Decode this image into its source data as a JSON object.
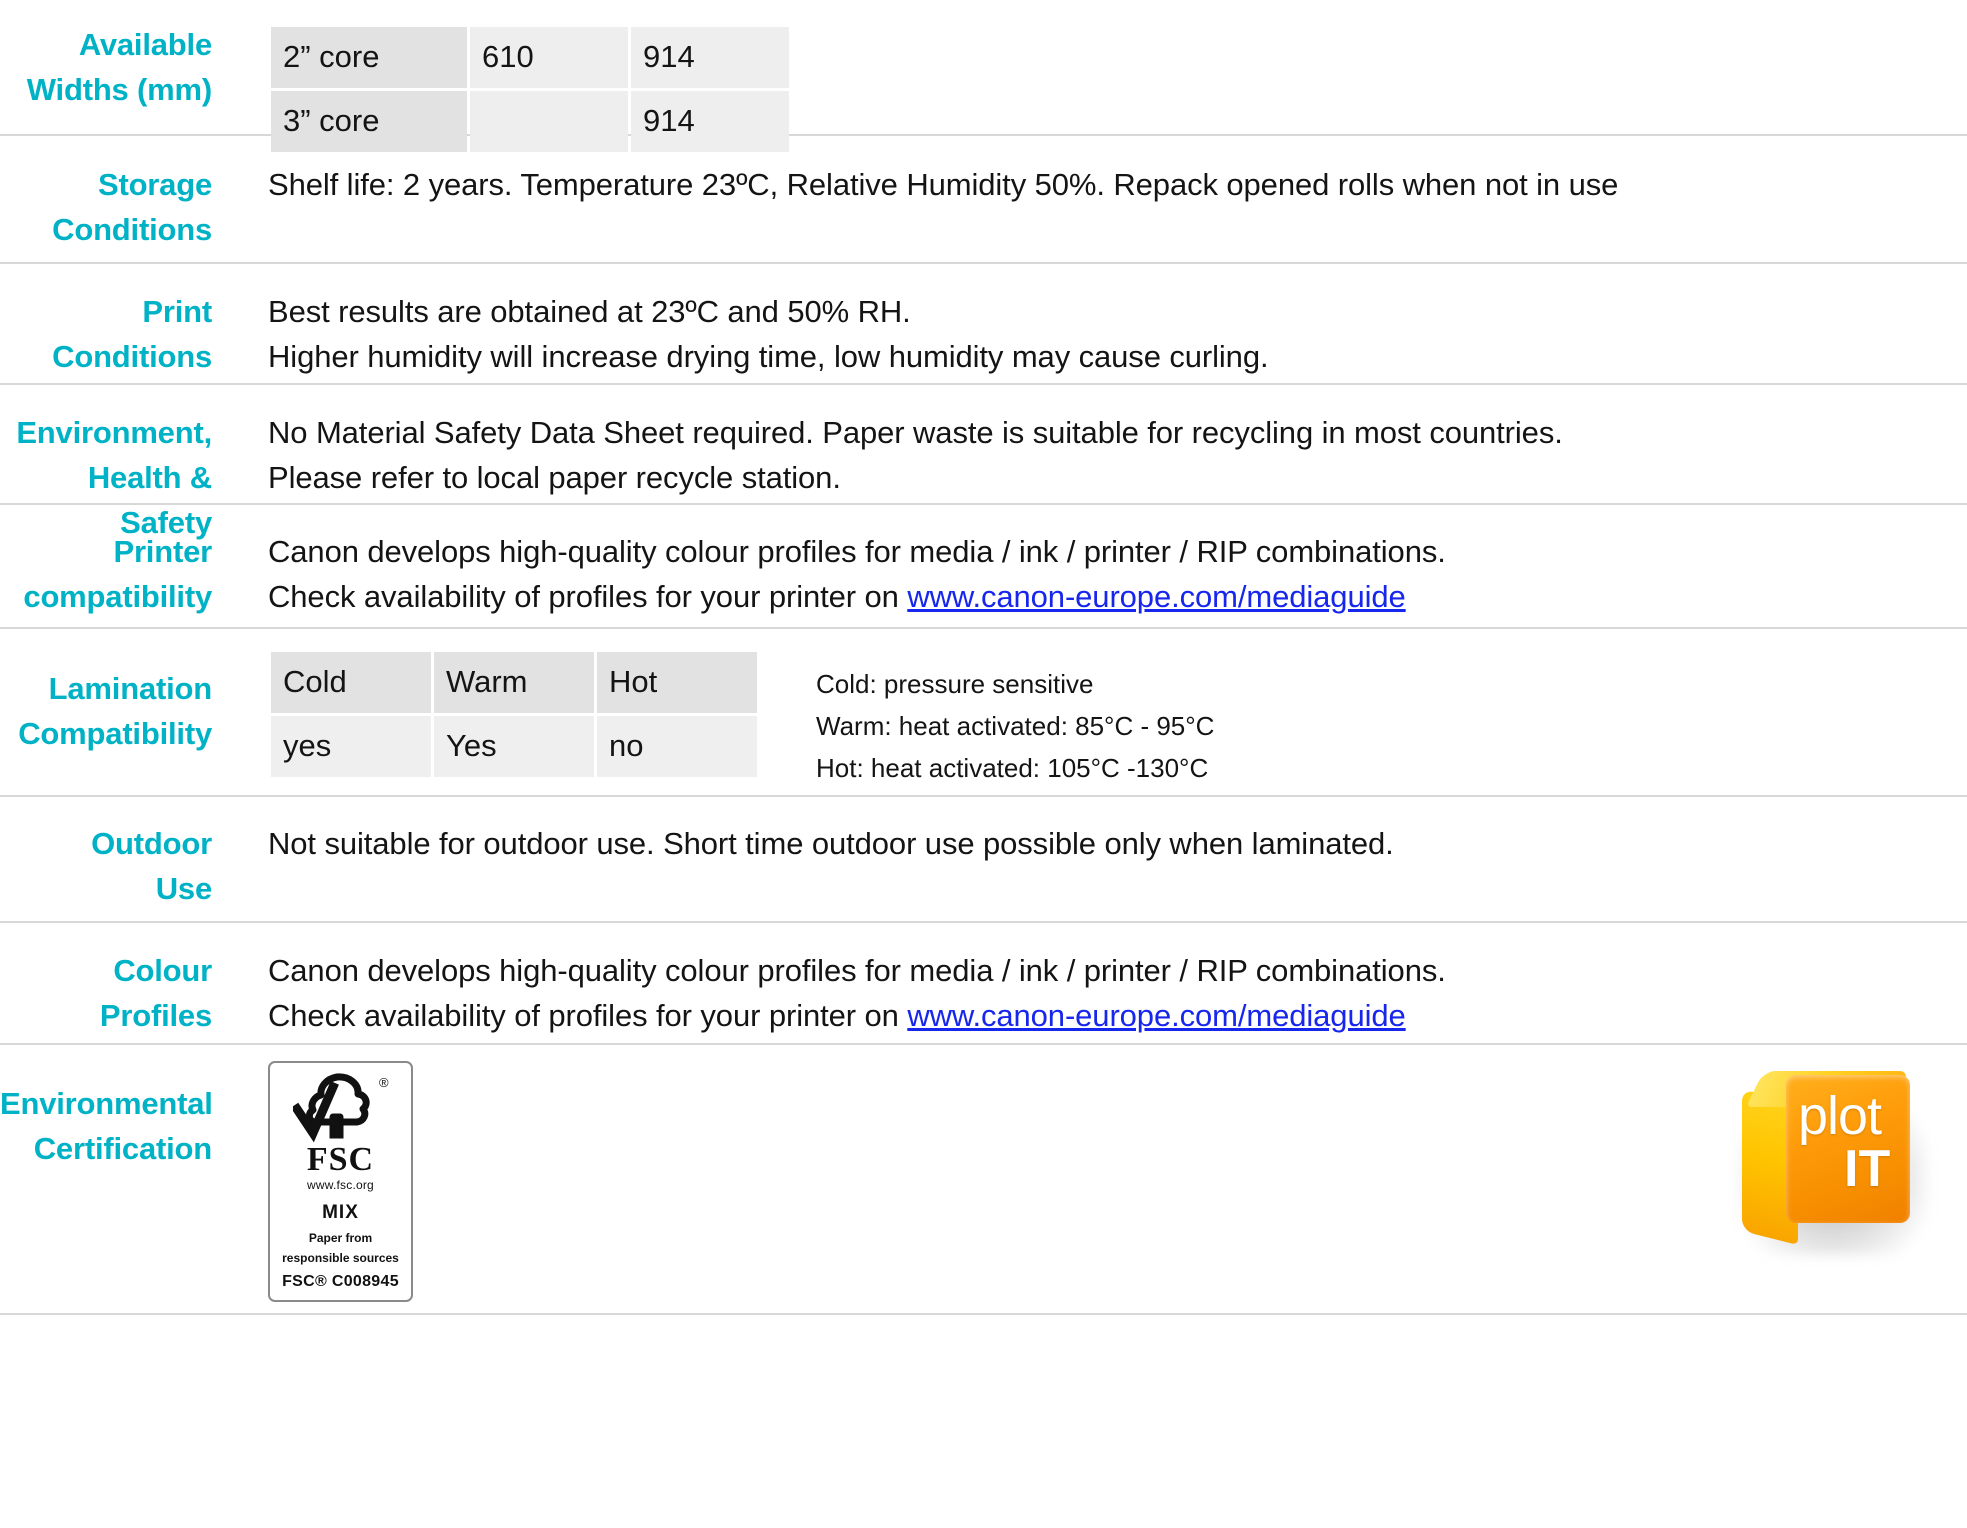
{
  "theme": {
    "label_color": "#00b2c6",
    "text_color": "#141414",
    "link_color": "#1626ec",
    "rule_color": "#d8d8d8",
    "table_header_bg": "#e2e2e2",
    "table_cell_bg": "#efefef"
  },
  "sections": {
    "available_widths": {
      "label_line1": "Available",
      "label_line2": "Widths (mm)",
      "rows": [
        {
          "core": "2” core",
          "w1": "610",
          "w2": "914"
        },
        {
          "core": "3” core",
          "w1": "",
          "w2": "914"
        }
      ]
    },
    "storage_conditions": {
      "label_line1": "Storage",
      "label_line2": "Conditions",
      "line1": "Shelf life: 2 years. Temperature 23ºC, Relative Humidity 50%. Repack opened rolls when not in use"
    },
    "print_conditions": {
      "label_line1": "Print",
      "label_line2": "Conditions",
      "line1": "Best results are obtained at 23ºC and 50% RH.",
      "line2": "Higher humidity will increase drying time, low humidity may cause curling."
    },
    "environment_health_safety": {
      "label_line1": "Environment,",
      "label_line2": "Health & Safety",
      "line1": "No Material Safety Data Sheet required. Paper waste is suitable for recycling in most countries.",
      "line2": "Please refer to local paper recycle station."
    },
    "printer_compatibility": {
      "label_line1": "Printer",
      "label_line2": "compatibility",
      "line1": "Canon develops high-quality colour profiles for media / ink / printer / RIP combinations.",
      "line2_prefix": "Check availability of profiles for your printer on ",
      "link_text": "www.canon-europe.com/mediaguide"
    },
    "lamination_compatibility": {
      "label_line1": "Lamination",
      "label_line2": "Compatibility",
      "headers": [
        "Cold",
        "Warm",
        "Hot"
      ],
      "values": [
        "yes",
        "Yes",
        "no"
      ],
      "notes": [
        "Cold: pressure sensitive",
        "Warm: heat activated: 85°C - 95°C",
        "Hot: heat activated: 105°C -130°C"
      ]
    },
    "outdoor_use": {
      "label_line1": "Outdoor",
      "label_line2": "Use",
      "line1": "Not suitable for outdoor use. Short time outdoor use possible only when laminated."
    },
    "colour_profiles": {
      "label_line1": "Colour",
      "label_line2": "Profiles",
      "line1": "Canon develops high-quality colour profiles for media / ink / printer / RIP combinations.",
      "line2_prefix": "Check availability of profiles for your printer on ",
      "link_text": "www.canon-europe.com/mediaguide"
    },
    "environmental_certification": {
      "label_line1": "Environmental",
      "label_line2": "Certification",
      "fsc": {
        "icon": "fsc-tree-checkmark-icon",
        "registered_mark": "®",
        "wordmark": "FSC",
        "url": "www.fsc.org",
        "mix": "MIX",
        "source_line1": "Paper from",
        "source_line2": "responsible sources",
        "code": "FSC® C008945"
      },
      "plotit_logo": {
        "text_top": "plot",
        "text_bottom": "IT",
        "icon": "plotit-cube-logo"
      }
    }
  }
}
